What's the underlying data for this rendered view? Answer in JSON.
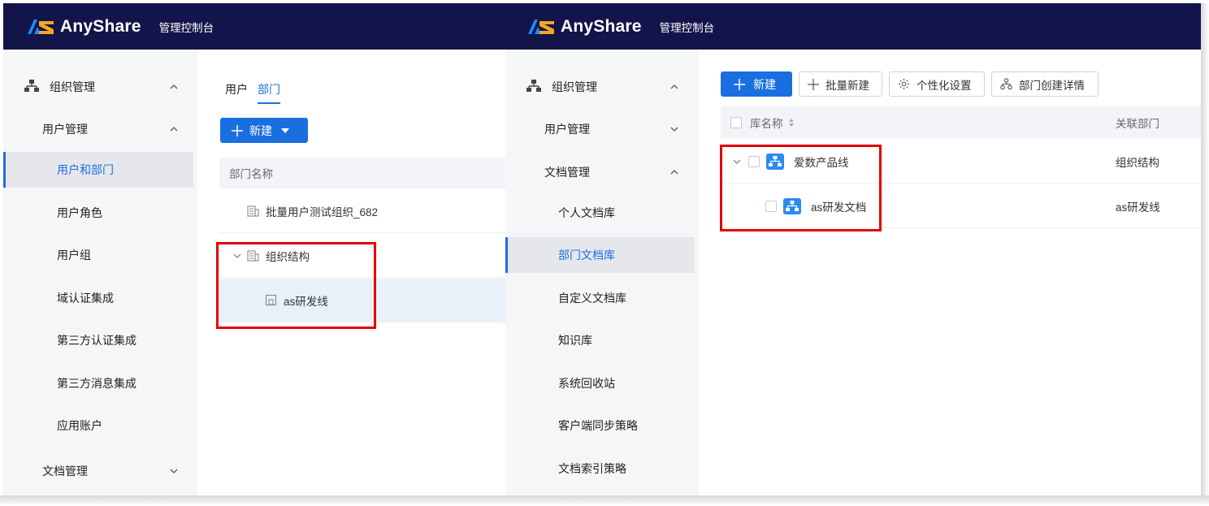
{
  "brand": {
    "logo_text": "AnyShare",
    "console_title": "管理控制台",
    "colors": {
      "topbar": "#13144a",
      "accent": "#1a6fe0",
      "logo_blue": "#1a8cff",
      "logo_orange": "#f5a623",
      "highlight_box": "#e30000"
    }
  },
  "left_panel": {
    "sidebar": {
      "group": {
        "icon": "org-tree-icon",
        "label": "组织管理"
      },
      "subgroup": {
        "label": "用户管理"
      },
      "items": [
        "用户和部门",
        "用户角色",
        "用户组",
        "域认证集成",
        "第三方认证集成",
        "第三方消息集成",
        "应用账户"
      ],
      "active_item": "用户和部门",
      "collapsed_group": {
        "label": "文档管理"
      }
    },
    "tabs": [
      "用户",
      "部门"
    ],
    "active_tab": "部门",
    "new_button": "新建",
    "table": {
      "header": "部门名称",
      "rows": [
        {
          "icon": "building-icon",
          "label": "批量用户测试组织_682"
        },
        {
          "icon": "building-icon",
          "label": "组织结构",
          "expanded": true
        },
        {
          "icon": "department-icon",
          "label": "as研发线",
          "selected": true
        }
      ]
    }
  },
  "right_panel": {
    "sidebar": {
      "group": {
        "icon": "org-tree-icon",
        "label": "组织管理"
      },
      "subgroup_user": {
        "label": "用户管理"
      },
      "subgroup_doc": {
        "label": "文档管理"
      },
      "items": [
        "个人文档库",
        "部门文档库",
        "自定义文档库",
        "知识库",
        "系统回收站",
        "客户端同步策略",
        "文档索引策略"
      ],
      "active_item": "部门文档库"
    },
    "toolbar": {
      "new_label": "新建",
      "batch_new_label": "批量新建",
      "personalize_label": "个性化设置",
      "dept_detail_label": "部门创建详情"
    },
    "table": {
      "col_name": "库名称",
      "col_dept": "关联部门",
      "rows": [
        {
          "name": "爱数产品线",
          "dept": "组织结构",
          "expanded": true
        },
        {
          "name": "as研发文档",
          "dept": "as研发线"
        }
      ]
    }
  }
}
